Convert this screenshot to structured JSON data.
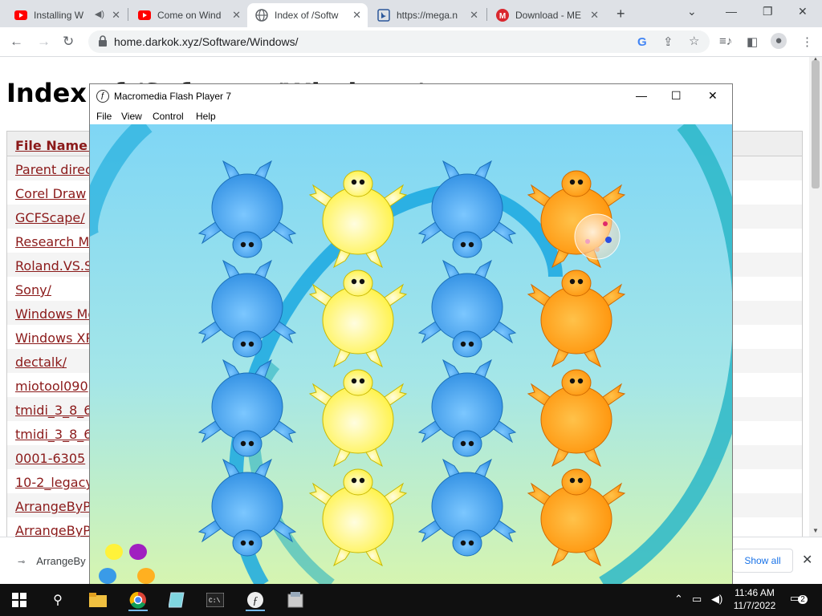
{
  "browser": {
    "tabs": [
      {
        "title": "Installing W",
        "favicon": "youtube-icon",
        "has_audio": true
      },
      {
        "title": "Come on Wind",
        "favicon": "youtube-icon"
      },
      {
        "title": "Index of /Softw",
        "favicon": "globe-icon",
        "active": true
      },
      {
        "title": "https://mega.n",
        "favicon": "bing-icon"
      },
      {
        "title": "Download - ME",
        "favicon": "mega-icon"
      }
    ],
    "url": "home.darkok.xyz/Software/Windows/"
  },
  "page": {
    "title": "Index of /Software/Windows/",
    "column_header": "File Name  ↓",
    "files": [
      "Parent directory/",
      "Corel Draw",
      "GCFScape/",
      "Research Ma",
      "Roland.VS.S",
      "Sony/",
      "Windows Mo",
      "Windows XP",
      "dectalk/",
      "miotool090",
      "tmidi_3_8_6",
      "tmidi_3_8_6",
      "0001-6305",
      "10-2_legacy",
      "ArrangeByPe",
      "ArrangeByPe"
    ]
  },
  "downloads": {
    "file": "ArrangeBy",
    "show_all": "Show all"
  },
  "flash": {
    "title": "Macromedia Flash Player 7",
    "menu": [
      "File",
      "View",
      "Control",
      "Help"
    ],
    "creature_colors": {
      "blue": "#3a9be8",
      "yellow": "#fff23a",
      "orange": "#ff9a10"
    }
  },
  "taskbar": {
    "time": "11:46 AM",
    "date": "11/7/2022",
    "notifications": "2"
  }
}
